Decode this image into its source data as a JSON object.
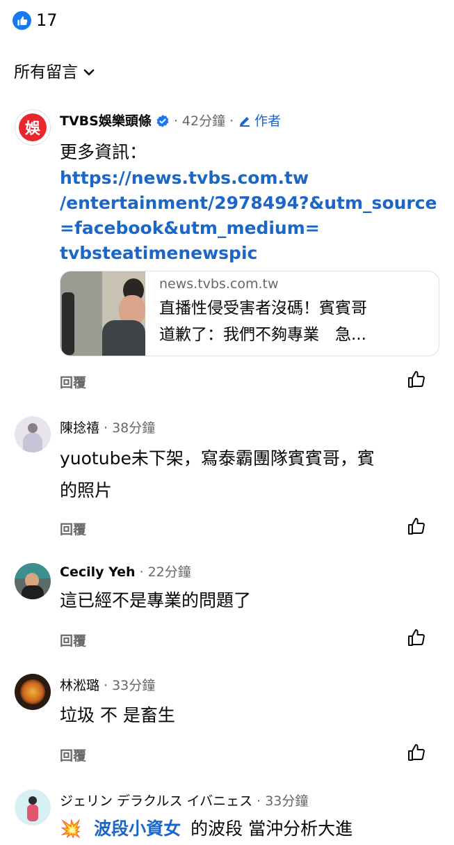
{
  "reactions": {
    "count": "17"
  },
  "filter": {
    "label": "所有留言"
  },
  "comments": [
    {
      "name": "TVBS娛樂頭條",
      "avatar_text": "娛",
      "time": "42分鐘",
      "author_label": "作者",
      "text": "更多資訊：",
      "link": "https://news.tvbs.com.tw/entertainment/2978494?&utm_source=facebook&utm_medium=tvbsteatimenewspic",
      "link_lines": [
        "https://news.tvbs.com.tw",
        "/entertainment/2978494?&utm_source",
        "=facebook&utm_medium=",
        "tvbsteatimenewspic"
      ],
      "card": {
        "domain": "news.tvbs.com.tw",
        "title_line1": "直播性侵受害者沒碼！賓賓哥",
        "title_line2": "道歉了：我們不夠專業　急..."
      },
      "reply": "回覆"
    },
    {
      "name": "陳捻禧",
      "time": "38分鐘",
      "line1": "yuotube未下架，寫泰霸團隊賓賓哥，賓",
      "line2": "的照片",
      "reply": "回覆"
    },
    {
      "name": "Cecily Yeh",
      "time": "22分鐘",
      "text": "這已經不是專業的問題了",
      "reply": "回覆"
    },
    {
      "name": "林淞璐",
      "time": "33分鐘",
      "text": "垃圾 不 是畜生",
      "reply": "回覆"
    },
    {
      "name": "ジェリン デラクルス イバニェス",
      "time": "33分鐘",
      "emoji": "💥",
      "mention": "波段小資女",
      "text": "的波段 當沖分析大進"
    }
  ],
  "colors": {
    "accent": "#1877f2",
    "link": "#1b66c9",
    "meta": "#65676b"
  },
  "icons": [
    "like-reaction-icon",
    "chevron-down-icon",
    "verified-badge-icon",
    "author-pen-icon",
    "thumbs-up-icon",
    "explosion-emoji"
  ]
}
